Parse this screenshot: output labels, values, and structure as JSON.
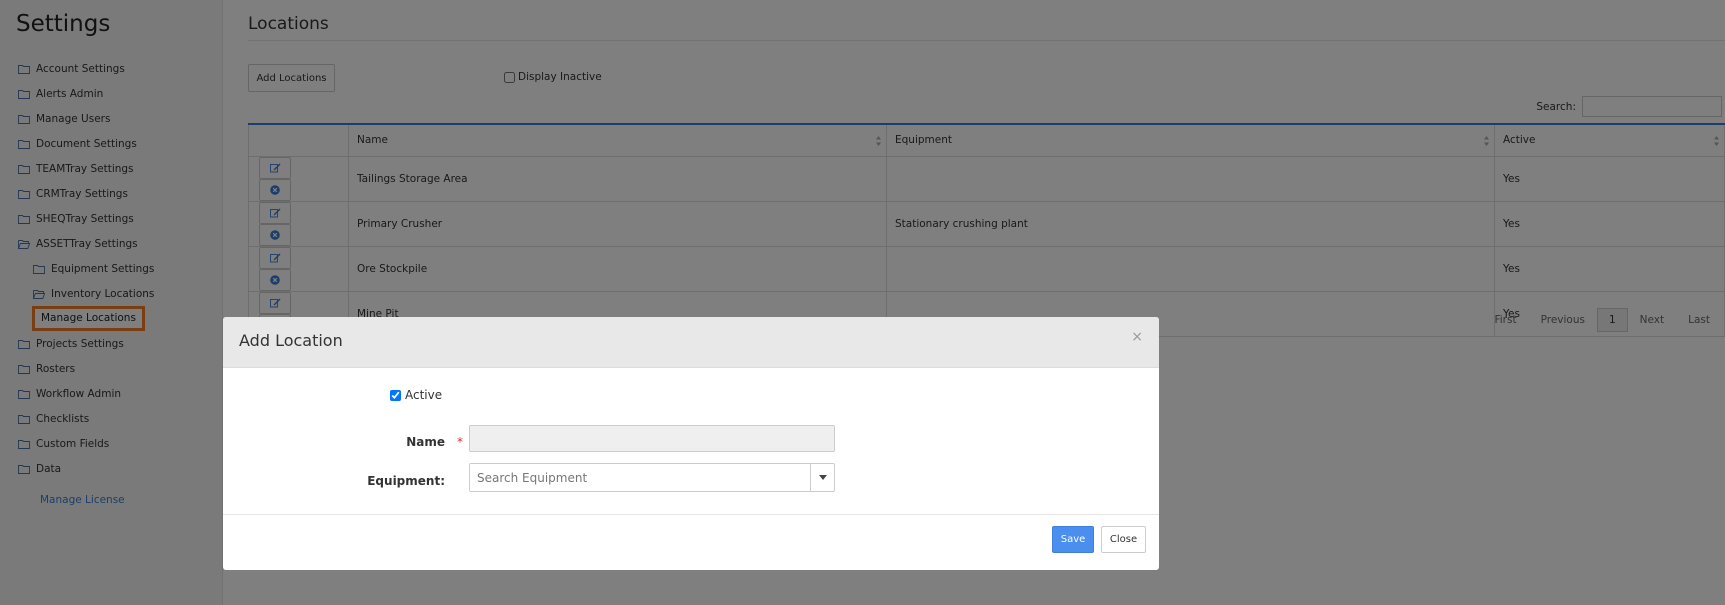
{
  "sidebar": {
    "title": "Settings",
    "items": [
      {
        "label": "Account Settings",
        "icon": "folder-icon"
      },
      {
        "label": "Alerts Admin",
        "icon": "folder-icon"
      },
      {
        "label": "Manage Users",
        "icon": "folder-icon"
      },
      {
        "label": "Document Settings",
        "icon": "folder-icon"
      },
      {
        "label": "TEAMTray Settings",
        "icon": "folder-icon"
      },
      {
        "label": "CRMTray Settings",
        "icon": "folder-icon"
      },
      {
        "label": "SHEQTray Settings",
        "icon": "folder-icon"
      },
      {
        "label": "ASSETTray Settings",
        "icon": "folder-open-icon"
      }
    ],
    "sub_items": [
      {
        "label": "Equipment Settings",
        "icon": "folder-icon"
      },
      {
        "label": "Inventory Locations",
        "icon": "folder-open-icon"
      }
    ],
    "active_item": "Manage Locations",
    "items_after": [
      {
        "label": "Projects Settings",
        "icon": "folder-icon"
      },
      {
        "label": "Rosters",
        "icon": "folder-icon"
      },
      {
        "label": "Workflow Admin",
        "icon": "folder-icon"
      },
      {
        "label": "Checklists",
        "icon": "folder-icon"
      },
      {
        "label": "Custom Fields",
        "icon": "folder-icon"
      },
      {
        "label": "Data",
        "icon": "folder-icon"
      }
    ],
    "license_link": "Manage License"
  },
  "main": {
    "title": "Locations",
    "add_button": "Add Locations",
    "display_inactive": "Display Inactive",
    "search_label": "Search:",
    "table": {
      "headers": [
        "Name",
        "Equipment",
        "Active"
      ],
      "rows": [
        {
          "name": "Tailings Storage Area",
          "equipment": "",
          "active": "Yes"
        },
        {
          "name": "Primary Crusher",
          "equipment": "Stationary crushing plant",
          "active": "Yes"
        },
        {
          "name": "Ore Stockpile",
          "equipment": "",
          "active": "Yes"
        },
        {
          "name": "Mine Pit",
          "equipment": "",
          "active": "Yes"
        }
      ]
    },
    "pager": {
      "first": "First",
      "previous": "Previous",
      "current": "1",
      "next": "Next",
      "last": "Last"
    }
  },
  "modal": {
    "title": "Add Location",
    "close_x": "×",
    "active_label": "Active",
    "name_label": "Name",
    "required_mark": "*",
    "name_value": "",
    "equipment_label": "Equipment:",
    "equipment_placeholder": "Search Equipment",
    "save": "Save",
    "close": "Close"
  },
  "colors": {
    "accent": "#4a8ef0",
    "highlight": "#f27c22",
    "link": "#3a7bd5",
    "required": "#d9342b"
  }
}
